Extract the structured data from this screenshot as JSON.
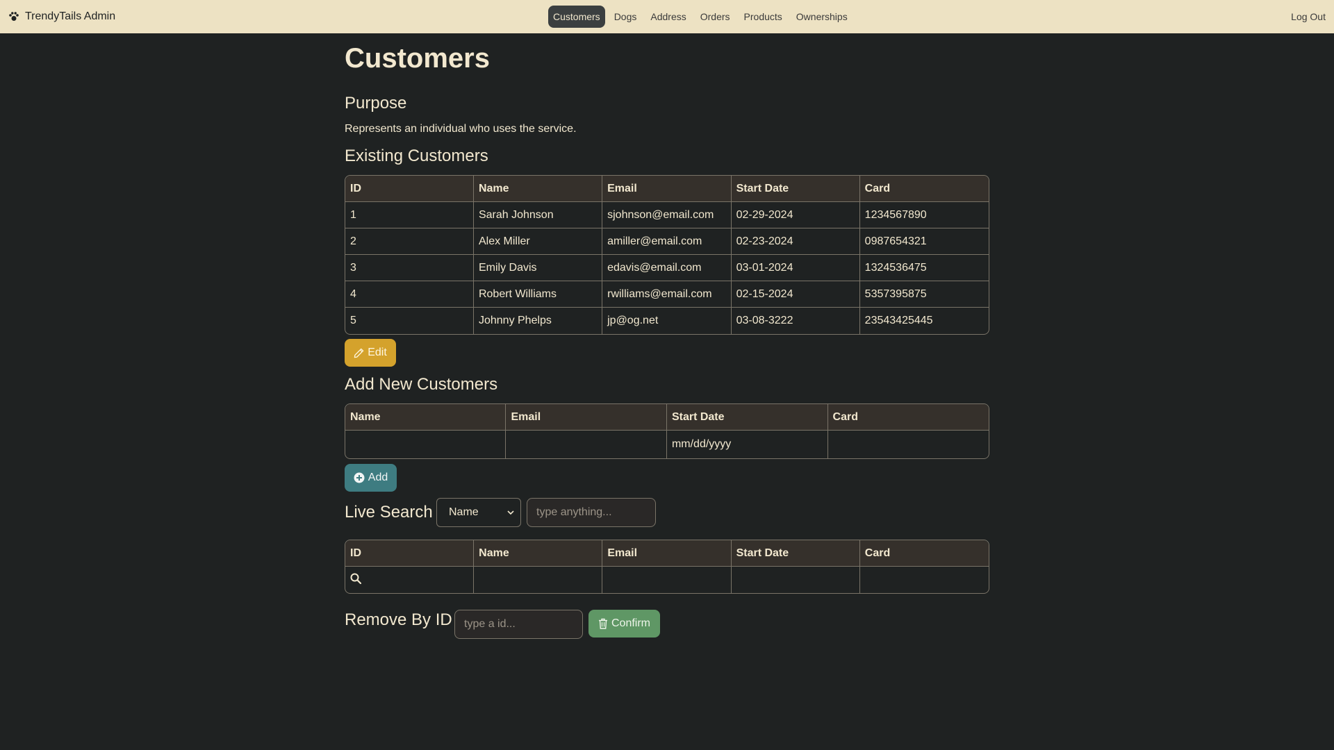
{
  "navbar": {
    "brand": "TrendyTails Admin",
    "links": [
      "Customers",
      "Dogs",
      "Address",
      "Orders",
      "Products",
      "Ownerships"
    ],
    "active": "Customers",
    "logout": "Log Out"
  },
  "page": {
    "title": "Customers",
    "purpose_heading": "Purpose",
    "purpose_text": "Represents an individual who uses the service.",
    "existing_heading": "Existing Customers",
    "add_heading": "Add New Customers",
    "live_search_heading": "Live Search",
    "remove_heading": "Remove By ID"
  },
  "existing_table": {
    "headers": [
      "ID",
      "Name",
      "Email",
      "Start Date",
      "Card"
    ],
    "rows": [
      [
        "1",
        "Sarah Johnson",
        "sjohnson@email.com",
        "02-29-2024",
        "1234567890"
      ],
      [
        "2",
        "Alex Miller",
        "amiller@email.com",
        "02-23-2024",
        "0987654321"
      ],
      [
        "3",
        "Emily Davis",
        "edavis@email.com",
        "03-01-2024",
        "1324536475"
      ],
      [
        "4",
        "Robert Williams",
        "rwilliams@email.com",
        "02-15-2024",
        "5357395875"
      ],
      [
        "5",
        "Johnny Phelps",
        "jp@og.net",
        "03-08-3222",
        "23543425445"
      ]
    ]
  },
  "buttons": {
    "edit": "Edit",
    "add": "Add",
    "confirm": "Confirm"
  },
  "add_table": {
    "headers": [
      "Name",
      "Email",
      "Start Date",
      "Card"
    ],
    "start_date_placeholder": "mm/dd/yyyy"
  },
  "live_search": {
    "select_value": "Name",
    "input_placeholder": "type anything...",
    "headers": [
      "ID",
      "Name",
      "Email",
      "Start Date",
      "Card"
    ]
  },
  "remove": {
    "input_placeholder": "type a id..."
  },
  "colors": {
    "background": "#1f2222",
    "navbar": "#ede2c3",
    "text": "#f2e8cf",
    "edit_button": "#d4a22c",
    "add_button": "#3e7c81",
    "confirm_button": "#5f9765"
  }
}
